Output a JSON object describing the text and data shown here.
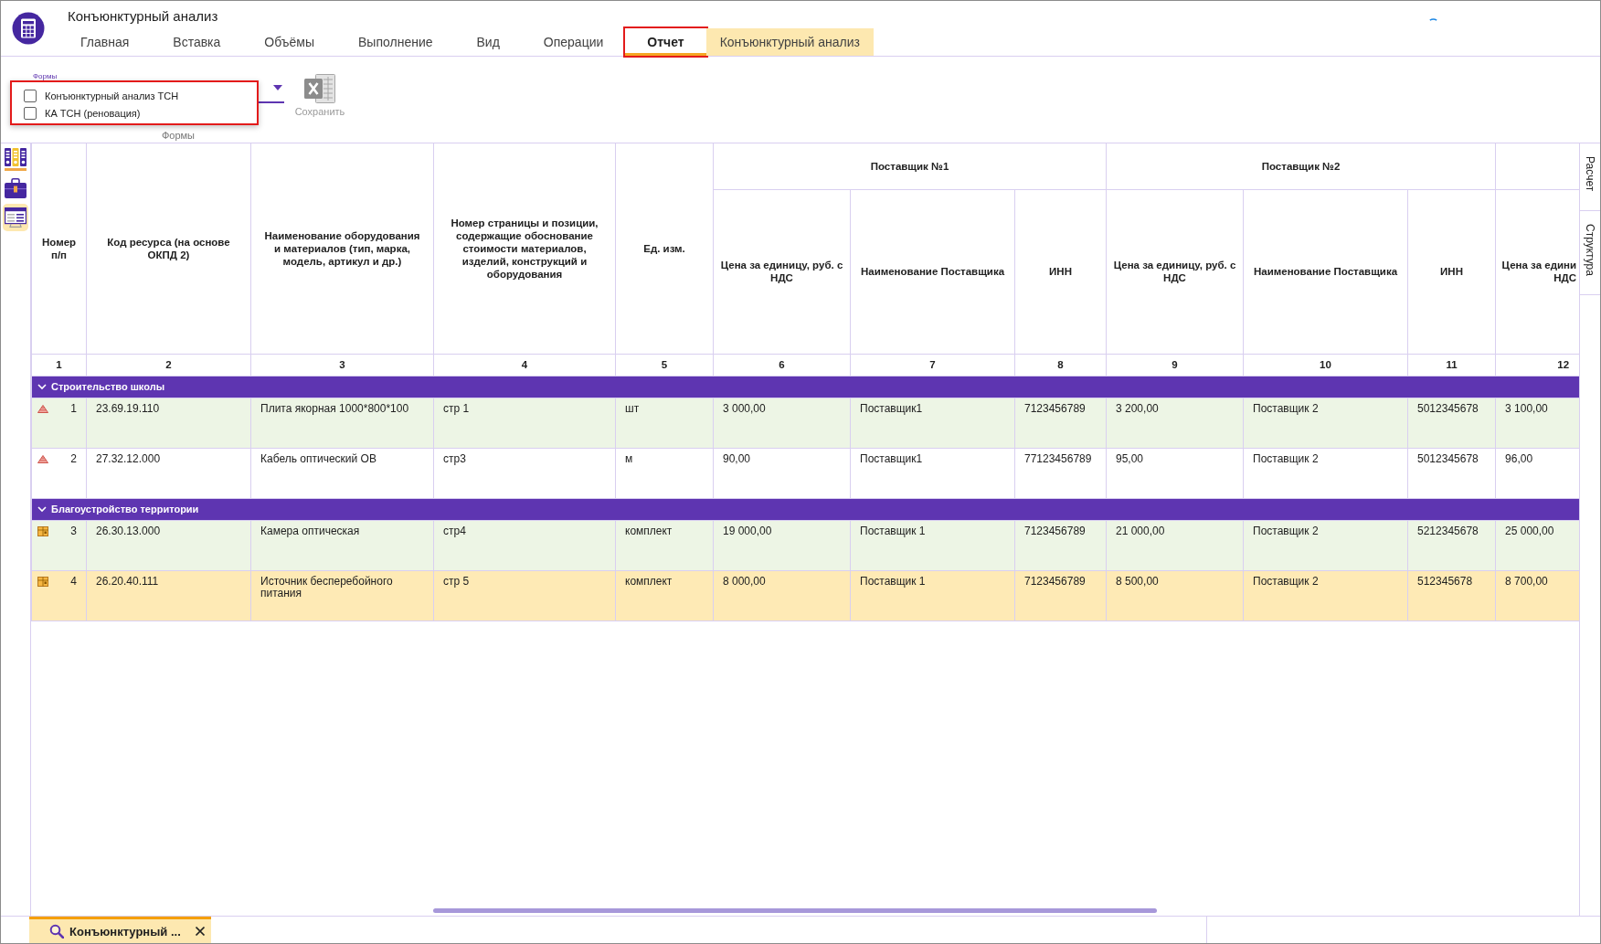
{
  "window": {
    "title": "Конъюнктурный анализ"
  },
  "ribbon_tabs": [
    {
      "label": "Главная",
      "kind": "regular",
      "selected": false,
      "annotated": false
    },
    {
      "label": "Вставка",
      "kind": "regular",
      "selected": false,
      "annotated": false
    },
    {
      "label": "Объёмы",
      "kind": "regular",
      "selected": false,
      "annotated": false
    },
    {
      "label": "Выполнение",
      "kind": "regular",
      "selected": false,
      "annotated": false
    },
    {
      "label": "Вид",
      "kind": "regular",
      "selected": false,
      "annotated": false
    },
    {
      "label": "Операции",
      "kind": "regular",
      "selected": false,
      "annotated": false
    },
    {
      "label": "Отчет",
      "kind": "regular",
      "selected": true,
      "annotated": true
    },
    {
      "label": "Конъюнктурный анализ",
      "kind": "contextual",
      "selected": false,
      "annotated": false
    }
  ],
  "ribbon": {
    "forms_dropdown": {
      "caption": "Формы",
      "expanded": true,
      "annotated": true,
      "options": [
        {
          "label": "Конъюнктурный анализ ТСН",
          "checked": false
        },
        {
          "label": "КА ТСН (реновация)",
          "checked": false
        }
      ]
    },
    "save_button": {
      "label": "Сохранить",
      "disabled": true
    },
    "group_label": "Формы"
  },
  "side_toolbar": [
    {
      "kind": "binders",
      "selected": false
    },
    {
      "kind": "briefcase",
      "selected": false
    },
    {
      "kind": "sheet",
      "selected": true
    }
  ],
  "table": {
    "columns": [
      {
        "heading": "Номер п/п",
        "number": "1"
      },
      {
        "heading": "Код ресурса (на основе ОКПД 2)",
        "number": "2"
      },
      {
        "heading": "Наименование оборудования и материалов (тип, марка, модель, артикул и др.)",
        "number": "3"
      },
      {
        "heading": "Номер страницы и позиции, содержащие обоснование стоимости материалов, изделий, конструкций и оборудования",
        "number": "4"
      },
      {
        "heading": "Ед. изм.",
        "number": "5"
      }
    ],
    "supplier_groups": [
      {
        "title": "Поставщик №1",
        "columns": [
          {
            "heading": "Цена за единицу, руб. с НДС",
            "number": "6"
          },
          {
            "heading": "Наименование Поставщика",
            "number": "7"
          },
          {
            "heading": "ИНН",
            "number": "8"
          }
        ]
      },
      {
        "title": "Поставщик №2",
        "columns": [
          {
            "heading": "Цена за единицу, руб. с НДС",
            "number": "9"
          },
          {
            "heading": "Наименование Поставщика",
            "number": "10"
          },
          {
            "heading": "ИНН",
            "number": "11"
          }
        ]
      },
      {
        "columns": [
          {
            "heading": "Цена за едини НДС",
            "number": "12"
          }
        ]
      }
    ],
    "sections": [
      {
        "title": "Строительство школы",
        "expanded": true,
        "rows": [
          {
            "kind": "material",
            "number": "1",
            "selected": false,
            "cells": [
              "23.69.19.110",
              "Плита якорная 1000*800*100",
              "стр 1",
              "шт",
              "3 000,00",
              "Поставщик1",
              "7123456789",
              "3 200,00",
              "Поставщик 2",
              "5012345678",
              "3 100,00"
            ]
          },
          {
            "kind": "material",
            "number": "2",
            "selected": false,
            "cells": [
              "27.32.12.000",
              "Кабель оптический ОВ",
              "стр3",
              "м",
              "90,00",
              "Поставщик1",
              "77123456789",
              "95,00",
              "Поставщик 2",
              "5012345678",
              "96,00"
            ]
          }
        ]
      },
      {
        "title": "Благоустройство территории",
        "expanded": true,
        "rows": [
          {
            "kind": "equipment",
            "number": "3",
            "selected": false,
            "cells": [
              "26.30.13.000",
              "Камера оптическая",
              "стр4",
              "комплект",
              "19 000,00",
              "Поставщик 1",
              "7123456789",
              "21 000,00",
              "Поставщик 2",
              "5212345678",
              "25 000,00"
            ]
          },
          {
            "kind": "equipment",
            "number": "4",
            "selected": true,
            "cells": [
              "26.20.40.111",
              "Источник бесперебойного питания",
              "стр 5",
              "комплект",
              "8 000,00",
              "Поставщик 1",
              "7123456789",
              "8 500,00",
              "Поставщик 2",
              "512345678",
              "8 700,00"
            ]
          }
        ]
      }
    ]
  },
  "side_panels": [
    {
      "label": "Расчет",
      "selected": false
    },
    {
      "label": "Структура",
      "selected": false
    }
  ],
  "document_tabs": [
    {
      "label": "Конъюнктурный ...",
      "selected": true
    }
  ]
}
